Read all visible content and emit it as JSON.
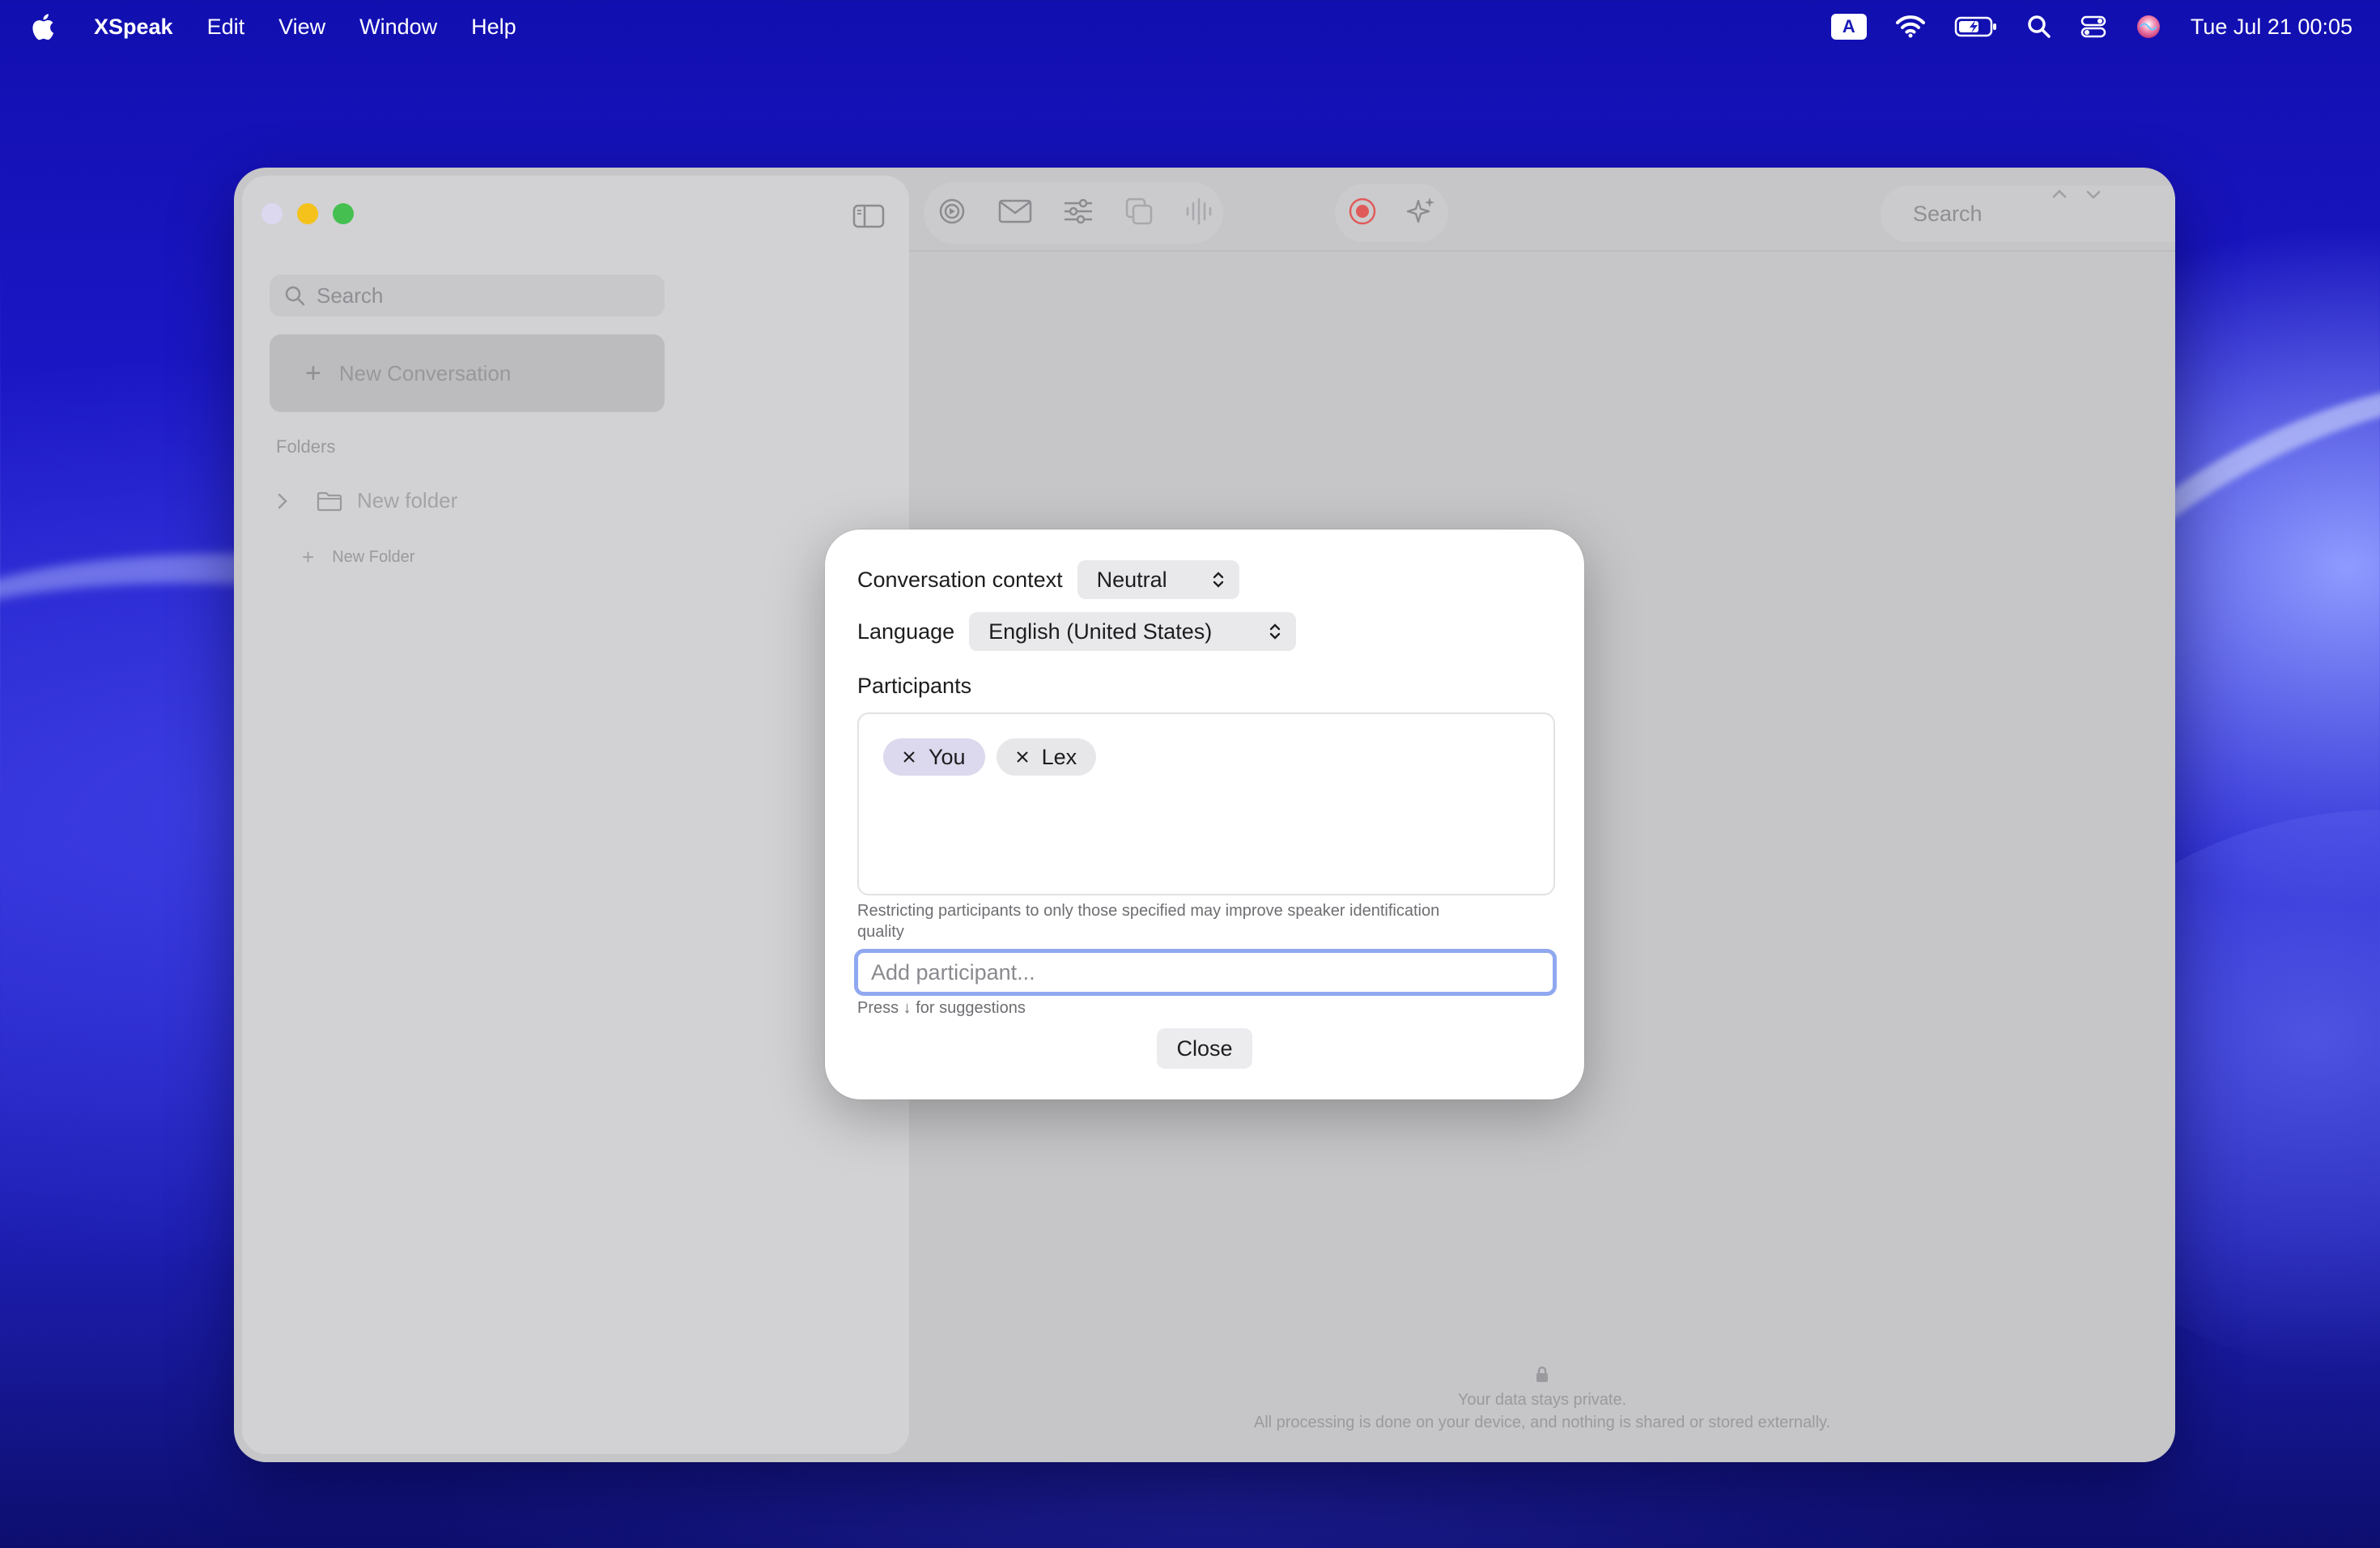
{
  "menubar": {
    "app_name": "XSpeak",
    "items": [
      "Edit",
      "View",
      "Window",
      "Help"
    ],
    "input_source": "A",
    "clock": "Tue Jul 21  00:05"
  },
  "sidebar": {
    "search_placeholder": "Search",
    "new_conversation": "New Conversation",
    "folders_title": "Folders",
    "folders": [
      {
        "label": "New folder"
      }
    ],
    "new_folder": "New Folder"
  },
  "toolbar": {
    "search_placeholder": "Search"
  },
  "privacy": {
    "line1": "Your data stays private.",
    "line2": "All processing is done on your device, and nothing is shared or stored externally."
  },
  "dialog": {
    "context_label": "Conversation context",
    "context_value": "Neutral",
    "language_label": "Language",
    "language_value": "English (United States)",
    "participants_title": "Participants",
    "participants": [
      {
        "name": "You"
      },
      {
        "name": "Lex"
      }
    ],
    "hint": "Restricting participants to only those specified may improve speaker identification quality",
    "input_placeholder": "Add participant...",
    "input_value": "",
    "press_hint": "Press ↓ for suggestions",
    "close_label": "Close"
  },
  "colors": {
    "accent_focus": "#90a8f0",
    "you_chip": "#dcd8ee",
    "record_red": "#e05a5a"
  }
}
